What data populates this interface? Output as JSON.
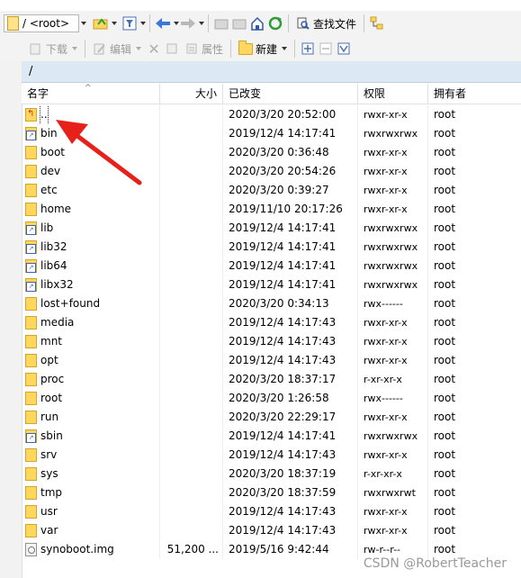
{
  "toolbar1": {
    "path_combo_value": "/ <root>",
    "find_files_label": "查找文件"
  },
  "toolbar2": {
    "download_label": "下载",
    "edit_label": "编辑",
    "properties_label": "属性",
    "new_label": "新建"
  },
  "address": {
    "path": "/"
  },
  "columns": {
    "name": "名字",
    "size": "大小",
    "modified": "已改变",
    "permissions": "权限",
    "owner": "拥有者"
  },
  "rows": [
    {
      "icon": "parent-dir-icon",
      "name": "..",
      "size": "",
      "modified": "2020/3/20 20:52:00",
      "permissions": "rwxr-xr-x",
      "owner": "root"
    },
    {
      "icon": "link-folder-icon",
      "name": "bin",
      "size": "",
      "modified": "2019/12/4 14:17:41",
      "permissions": "rwxrwxrwx",
      "owner": "root"
    },
    {
      "icon": "folder-icon",
      "name": "boot",
      "size": "",
      "modified": "2020/3/20 0:36:48",
      "permissions": "rwxr-xr-x",
      "owner": "root"
    },
    {
      "icon": "folder-icon",
      "name": "dev",
      "size": "",
      "modified": "2020/3/20 20:54:26",
      "permissions": "rwxr-xr-x",
      "owner": "root"
    },
    {
      "icon": "folder-icon",
      "name": "etc",
      "size": "",
      "modified": "2020/3/20 0:39:27",
      "permissions": "rwxr-xr-x",
      "owner": "root"
    },
    {
      "icon": "folder-icon",
      "name": "home",
      "size": "",
      "modified": "2019/11/10 20:17:26",
      "permissions": "rwxr-xr-x",
      "owner": "root"
    },
    {
      "icon": "link-folder-icon",
      "name": "lib",
      "size": "",
      "modified": "2019/12/4 14:17:41",
      "permissions": "rwxrwxrwx",
      "owner": "root"
    },
    {
      "icon": "link-folder-icon",
      "name": "lib32",
      "size": "",
      "modified": "2019/12/4 14:17:41",
      "permissions": "rwxrwxrwx",
      "owner": "root"
    },
    {
      "icon": "link-folder-icon",
      "name": "lib64",
      "size": "",
      "modified": "2019/12/4 14:17:41",
      "permissions": "rwxrwxrwx",
      "owner": "root"
    },
    {
      "icon": "link-folder-icon",
      "name": "libx32",
      "size": "",
      "modified": "2019/12/4 14:17:41",
      "permissions": "rwxrwxrwx",
      "owner": "root"
    },
    {
      "icon": "folder-icon",
      "name": "lost+found",
      "size": "",
      "modified": "2020/3/20 0:34:13",
      "permissions": "rwx------",
      "owner": "root"
    },
    {
      "icon": "folder-icon",
      "name": "media",
      "size": "",
      "modified": "2019/12/4 14:17:43",
      "permissions": "rwxr-xr-x",
      "owner": "root"
    },
    {
      "icon": "folder-icon",
      "name": "mnt",
      "size": "",
      "modified": "2019/12/4 14:17:43",
      "permissions": "rwxr-xr-x",
      "owner": "root"
    },
    {
      "icon": "folder-icon",
      "name": "opt",
      "size": "",
      "modified": "2019/12/4 14:17:43",
      "permissions": "rwxr-xr-x",
      "owner": "root"
    },
    {
      "icon": "folder-icon",
      "name": "proc",
      "size": "",
      "modified": "2020/3/20 18:37:17",
      "permissions": "r-xr-xr-x",
      "owner": "root"
    },
    {
      "icon": "folder-icon",
      "name": "root",
      "size": "",
      "modified": "2020/3/20 1:26:58",
      "permissions": "rwx------",
      "owner": "root"
    },
    {
      "icon": "folder-icon",
      "name": "run",
      "size": "",
      "modified": "2020/3/20 22:29:17",
      "permissions": "rwxr-xr-x",
      "owner": "root"
    },
    {
      "icon": "link-folder-icon",
      "name": "sbin",
      "size": "",
      "modified": "2019/12/4 14:17:41",
      "permissions": "rwxrwxrwx",
      "owner": "root"
    },
    {
      "icon": "folder-icon",
      "name": "srv",
      "size": "",
      "modified": "2019/12/4 14:17:43",
      "permissions": "rwxr-xr-x",
      "owner": "root"
    },
    {
      "icon": "folder-icon",
      "name": "sys",
      "size": "",
      "modified": "2020/3/20 18:37:19",
      "permissions": "r-xr-xr-x",
      "owner": "root"
    },
    {
      "icon": "folder-icon",
      "name": "tmp",
      "size": "",
      "modified": "2020/3/20 18:37:59",
      "permissions": "rwxrwxrwt",
      "owner": "root"
    },
    {
      "icon": "folder-icon",
      "name": "usr",
      "size": "",
      "modified": "2019/12/4 14:17:43",
      "permissions": "rwxr-xr-x",
      "owner": "root"
    },
    {
      "icon": "folder-icon",
      "name": "var",
      "size": "",
      "modified": "2019/12/4 14:17:43",
      "permissions": "rwxr-xr-x",
      "owner": "root"
    },
    {
      "icon": "file-icon",
      "name": "synoboot.img",
      "size": "51,200 ...",
      "modified": "2019/5/16 9:42:44",
      "permissions": "rw-r--r--",
      "owner": "root"
    }
  ],
  "watermark": "CSDN @RobertTeacher",
  "colors": {
    "address_bar": "#dce8f4",
    "annotation_arrow": "#e8201a",
    "folder": "#ffd75e"
  }
}
